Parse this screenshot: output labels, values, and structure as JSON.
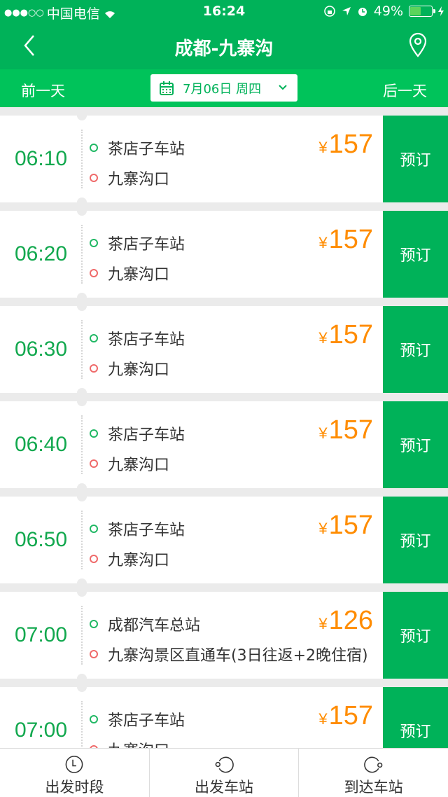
{
  "status_bar": {
    "signal": "●●●○○",
    "carrier": "中国电信",
    "time": "16:24",
    "battery_percent": "49%",
    "battery_level": 0.49
  },
  "nav": {
    "title": "成都-九寨沟"
  },
  "date_bar": {
    "prev_label": "前一天",
    "next_label": "后一天",
    "date": "7月06日 周四"
  },
  "colors": {
    "primary": "#00b259",
    "price": "#ff8c00",
    "time": "#12a84e"
  },
  "schedules": [
    {
      "time": "06:10",
      "from": "茶店子车站",
      "to": "九寨沟口",
      "currency": "¥",
      "price": "157",
      "book_label": "预订"
    },
    {
      "time": "06:20",
      "from": "茶店子车站",
      "to": "九寨沟口",
      "currency": "¥",
      "price": "157",
      "book_label": "预订"
    },
    {
      "time": "06:30",
      "from": "茶店子车站",
      "to": "九寨沟口",
      "currency": "¥",
      "price": "157",
      "book_label": "预订"
    },
    {
      "time": "06:40",
      "from": "茶店子车站",
      "to": "九寨沟口",
      "currency": "¥",
      "price": "157",
      "book_label": "预订"
    },
    {
      "time": "06:50",
      "from": "茶店子车站",
      "to": "九寨沟口",
      "currency": "¥",
      "price": "157",
      "book_label": "预订"
    },
    {
      "time": "07:00",
      "from": "成都汽车总站",
      "to": "九寨沟景区直通车(3日往返+2晚住宿)",
      "currency": "¥",
      "price": "126",
      "book_label": "预订"
    },
    {
      "time": "07:00",
      "from": "茶店子车站",
      "to": "九寨沟口",
      "currency": "¥",
      "price": "157",
      "book_label": "预订"
    }
  ],
  "tabbar": [
    {
      "label": "出发时段",
      "icon": "clock-icon"
    },
    {
      "label": "出发车站",
      "icon": "departure-station-icon"
    },
    {
      "label": "到达车站",
      "icon": "arrival-station-icon"
    }
  ]
}
